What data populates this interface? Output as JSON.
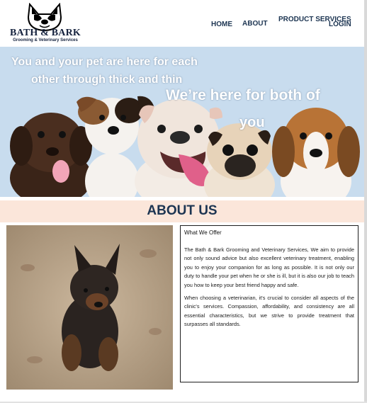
{
  "header": {
    "logo_title": "BATH & BARK",
    "logo_subtitle": "Grooming & Veterinary Services",
    "nav": {
      "home": "HOME",
      "about": "ABOUT",
      "product_services": "PRODUCT SERVICES",
      "login": "LOGIN"
    }
  },
  "hero": {
    "line1": "You and your pet are here for each",
    "line2": "other through thick and thin",
    "line3": "We’re here for both of",
    "line4": "you"
  },
  "about": {
    "title": "ABOUT US",
    "box_heading": "What We Offer",
    "paragraph1": "The Bath & Bark Grooming and Veterinary Services, We aim to provide not only sound advice but also excellent veterinary treatment, enabling you to enjoy your companion for as long as possible. It is not only our duty to handle your pet when he or she is ill, but it is also our job to teach you how to keep your best friend happy and safe.",
    "paragraph2": "When choosing a veterinarian, it's crucial to consider all aspects of the clinic's services. Compassion, affordability, and consistency are all essential characteristics, but we strive to provide treatment that surpasses all standards."
  },
  "colors": {
    "nav_text": "#1d3552",
    "hero_bg": "#c8dcee",
    "about_band": "#fbe6da",
    "about_title": "#1d3552"
  }
}
